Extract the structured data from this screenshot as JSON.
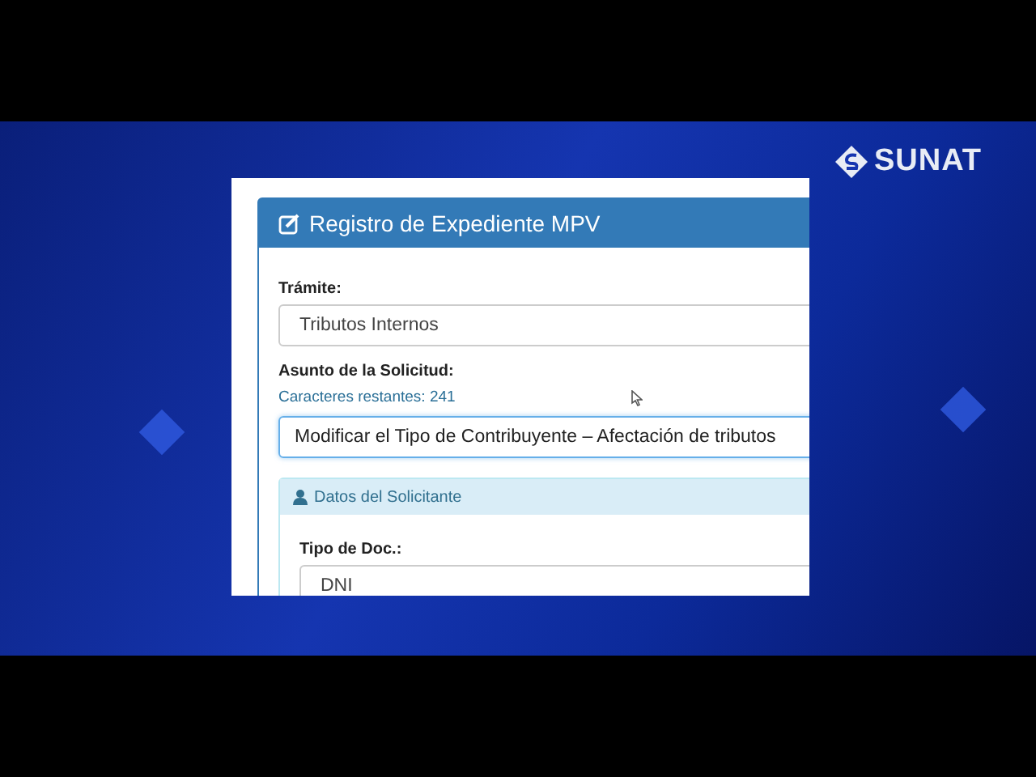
{
  "logo": {
    "text": "SUNAT"
  },
  "panel": {
    "title": "Registro de Expediente MPV",
    "fields": [
      {
        "label": "Trámite:",
        "value": "Tributos Internos",
        "focused": false
      },
      {
        "label": "Asunto de la Solicitud:",
        "hint": "Caracteres restantes: 241",
        "value": "Modificar el Tipo de Contribuyente – Afectación de tributos",
        "focused": true
      }
    ],
    "subpanel": {
      "title": "Datos del Solicitante",
      "fields": [
        {
          "label": "Tipo de Doc.:",
          "value": "DNI",
          "focused": false
        }
      ]
    }
  }
}
